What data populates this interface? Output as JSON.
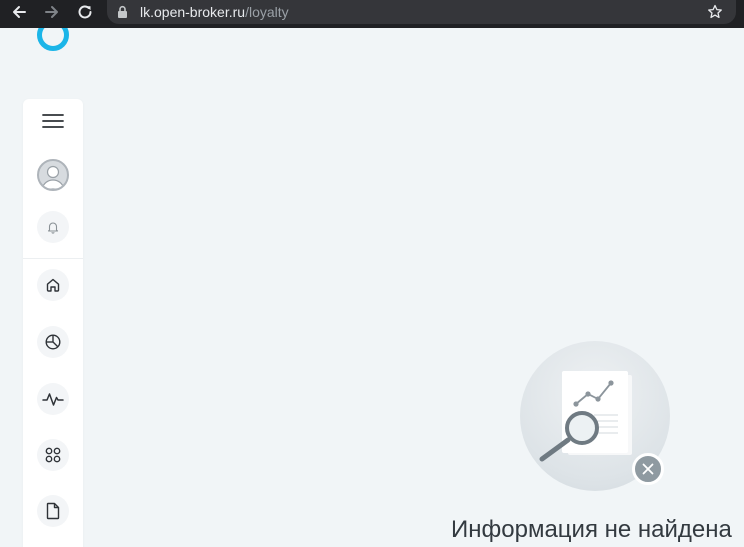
{
  "browser": {
    "url_host": "lk.open-broker.ru",
    "url_path": "/loyalty",
    "icons": {
      "back": "arrow-left-icon",
      "forward": "arrow-right-icon",
      "reload": "reload-icon",
      "lock": "lock-icon",
      "bookmark": "star-icon"
    }
  },
  "brand": {
    "logo": "open-logo-icon",
    "accent_color": "#1bb5e8"
  },
  "sidebar": {
    "items": [
      {
        "id": "menu",
        "icon": "hamburger-menu-icon"
      },
      {
        "id": "profile",
        "icon": "user-avatar-icon"
      },
      {
        "id": "notifications",
        "icon": "bell-icon"
      },
      {
        "id": "home",
        "icon": "home-icon"
      },
      {
        "id": "portfolio",
        "icon": "pie-chart-icon"
      },
      {
        "id": "analytics",
        "icon": "pulse-icon"
      },
      {
        "id": "services",
        "icon": "grid-dots-icon"
      },
      {
        "id": "documents",
        "icon": "document-icon"
      }
    ]
  },
  "empty_state": {
    "title": "Информация не найдена",
    "illustration": "document-search-icon",
    "badge": "close-icon"
  }
}
